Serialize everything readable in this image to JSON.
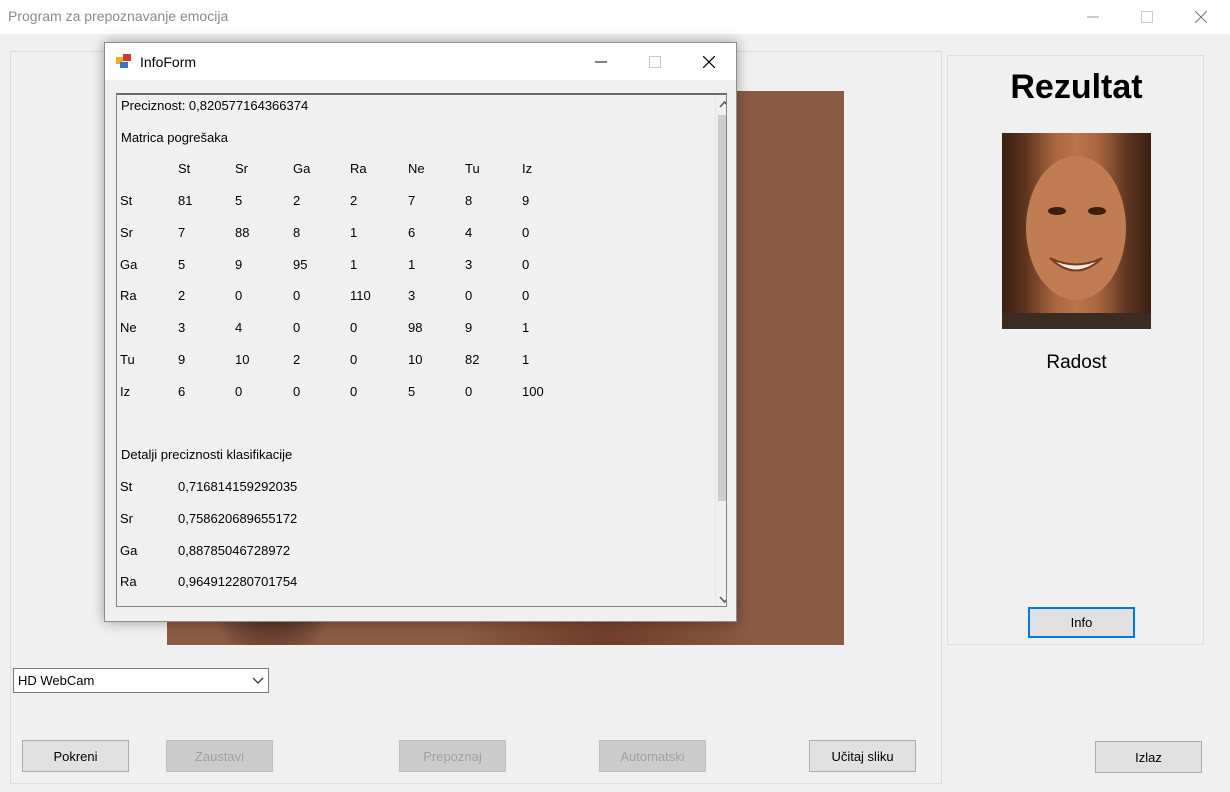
{
  "window": {
    "title": "Program za prepoznavanje emocija"
  },
  "camera_select": {
    "value": "HD WebCam"
  },
  "buttons": {
    "start": "Pokreni",
    "stop": "Zaustavi",
    "recognize": "Prepoznaj",
    "automatic": "Automatski",
    "load_image": "Učitaj sliku",
    "exit": "Izlaz",
    "info": "Info"
  },
  "result": {
    "title": "Rezultat",
    "emotion": "Radost"
  },
  "dialog": {
    "title": "InfoForm",
    "precision_line": "Preciznost: 0,820577164366374",
    "matrix_title": "Matrica pogrešaka",
    "matrix_header": [
      "St",
      "Sr",
      "Ga",
      "Ra",
      "Ne",
      "Tu",
      "Iz"
    ],
    "matrix_rows": [
      {
        "label": "St",
        "values": [
          "81",
          "5",
          "2",
          "2",
          "7",
          "8",
          "9"
        ]
      },
      {
        "label": "Sr",
        "values": [
          "7",
          "88",
          "8",
          "1",
          "6",
          "4",
          "0"
        ]
      },
      {
        "label": "Ga",
        "values": [
          "5",
          "9",
          "95",
          "1",
          "1",
          "3",
          "0"
        ]
      },
      {
        "label": "Ra",
        "values": [
          "2",
          "0",
          "0",
          "110",
          "3",
          "0",
          "0"
        ]
      },
      {
        "label": "Ne",
        "values": [
          "3",
          "4",
          "0",
          "0",
          "98",
          "9",
          "1"
        ]
      },
      {
        "label": "Tu",
        "values": [
          "9",
          "10",
          "2",
          "0",
          "10",
          "82",
          "1"
        ]
      },
      {
        "label": "Iz",
        "values": [
          "6",
          "0",
          "0",
          "0",
          "5",
          "0",
          "100"
        ]
      }
    ],
    "details_title": "Detalji preciznosti klasifikacije",
    "details": [
      {
        "label": "St",
        "value": "0,716814159292035"
      },
      {
        "label": "Sr",
        "value": "0,758620689655172"
      },
      {
        "label": "Ga",
        "value": "0,88785046728972"
      },
      {
        "label": "Ra",
        "value": "0,964912280701754"
      }
    ]
  }
}
